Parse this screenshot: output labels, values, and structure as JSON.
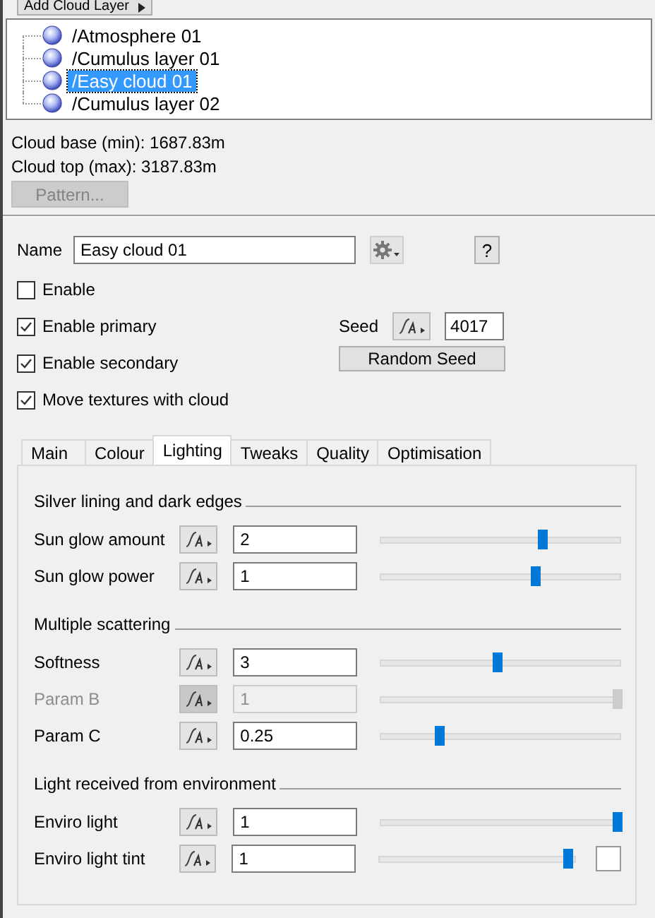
{
  "add_button": {
    "label": "Add Cloud Layer"
  },
  "tree": {
    "items": [
      {
        "label": "/Atmosphere 01",
        "selected": false
      },
      {
        "label": "/Cumulus layer 01",
        "selected": false
      },
      {
        "label": "/Easy cloud 01",
        "selected": true
      },
      {
        "label": "/Cumulus layer 02",
        "selected": false
      }
    ]
  },
  "info": [
    "Cloud base (min): 1687.83m",
    "Cloud top (max): 3187.83m"
  ],
  "pattern_button": {
    "label": "Pattern...",
    "disabled": true
  },
  "name": {
    "label": "Name",
    "value": "Easy cloud 01"
  },
  "help": "?",
  "checks": [
    {
      "label": "Enable",
      "checked": false
    },
    {
      "label": "Enable primary",
      "checked": true
    },
    {
      "label": "Enable secondary",
      "checked": true
    },
    {
      "label": "Move textures with cloud",
      "checked": true
    }
  ],
  "seed": {
    "label": "Seed",
    "value": "4017",
    "button": "Random Seed"
  },
  "tabs": [
    {
      "label": "Main",
      "selected": false
    },
    {
      "label": "Colour",
      "selected": false
    },
    {
      "label": "Lighting",
      "selected": true
    },
    {
      "label": "Tweaks",
      "selected": false
    },
    {
      "label": "Quality",
      "selected": false
    },
    {
      "label": "Optimisation",
      "selected": false
    }
  ],
  "groups": [
    {
      "title": "Silver lining and dark edges",
      "rows": [
        {
          "label": "Sun glow amount",
          "value": "2",
          "level": 0.69,
          "disabled": false,
          "kind": "slider"
        },
        {
          "label": "Sun glow power",
          "value": "1",
          "level": 0.66,
          "disabled": false,
          "kind": "slider"
        }
      ]
    },
    {
      "title": "Multiple scattering",
      "rows": [
        {
          "label": "Softness",
          "value": "3",
          "level": 0.5,
          "disabled": false,
          "kind": "slider"
        },
        {
          "label": "Param B",
          "value": "1",
          "level": 1,
          "disabled": true,
          "kind": "slider"
        },
        {
          "label": "Param C",
          "value": "0.25",
          "level": 0.26,
          "disabled": false,
          "kind": "slider"
        }
      ]
    },
    {
      "title": "Light received from environment",
      "rows": [
        {
          "label": "Enviro light",
          "value": "1",
          "level": 1,
          "disabled": false,
          "kind": "slider"
        },
        {
          "label": "Enviro light tint",
          "value": "1",
          "level": 0.98,
          "disabled": false,
          "kind": "swatch"
        }
      ]
    }
  ]
}
